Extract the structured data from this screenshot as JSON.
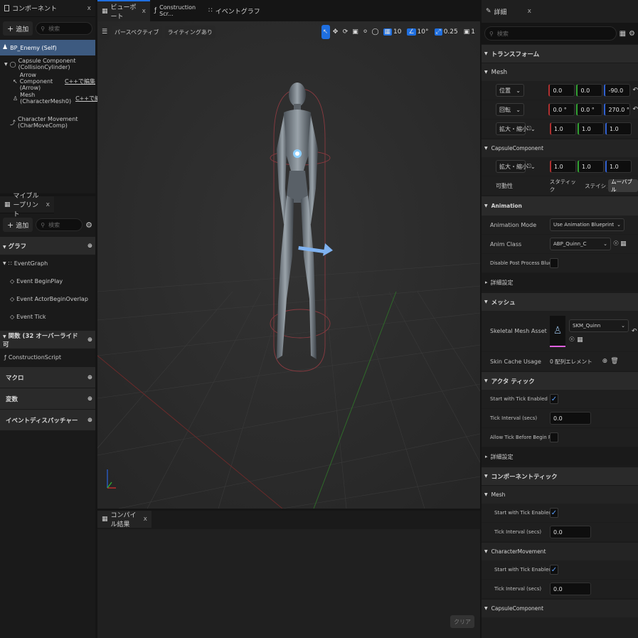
{
  "components_panel": {
    "tab_label": "コンポーネント",
    "add_label": "追加",
    "search_placeholder": "検索",
    "tree": [
      {
        "label": "BP_Enemy (Self)",
        "selected": true
      },
      {
        "label": "Capsule Component (CollisionCylinder)"
      },
      {
        "label": "Arrow Component (Arrow)",
        "edit_link": "C++で編集"
      },
      {
        "label": "Mesh (CharacterMesh0)",
        "edit_link": "C++で編集"
      },
      {
        "label": "Character Movement (CharMoveComp)"
      }
    ]
  },
  "myblueprint_panel": {
    "tab_label": "マイブループリント",
    "add_label": "追加",
    "search_placeholder": "検索",
    "sections": {
      "graph": "グラフ",
      "functions": "関数 (32 オーバーライド可",
      "macros": "マクロ",
      "variables": "変数",
      "dispatchers": "イベントディスパッチャー"
    },
    "event_graph": "EventGraph",
    "events": [
      "Event BeginPlay",
      "Event ActorBeginOverlap",
      "Event Tick"
    ],
    "construction_script": "ConstructionScript"
  },
  "center_tabs": {
    "viewport": "ビューポート",
    "construction": "Construction Scr...",
    "event_graph": "イベントグラフ"
  },
  "viewport_toolbar": {
    "perspective": "パースペクティブ",
    "lighting": "ライティングあり",
    "grid_snap": "10",
    "rot_snap": "10°",
    "scale_snap": "0.25",
    "camera_speed": "1"
  },
  "compile_panel": {
    "tab_label": "コンパイル結果",
    "clear_label": "クリア"
  },
  "details_panel": {
    "tab_label": "詳細",
    "search_placeholder": "検索",
    "transform_section": "トランスフォーム",
    "mesh_sub": "Mesh",
    "location_label": "位置",
    "location": [
      "0.0",
      "0.0",
      "-90.0"
    ],
    "rotation_label": "回転",
    "rotation": [
      "0.0 °",
      "0.0 °",
      "270.0 °"
    ],
    "scale_label": "拡大・縮小",
    "scale": [
      "1.0",
      "1.0",
      "1.0"
    ],
    "capsule_sub": "CapsuleComponent",
    "capsule_scale": [
      "1.0",
      "1.0",
      "1.0"
    ],
    "mobility_label": "可動性",
    "mobility_options": [
      "スタティック",
      "ステイショナリ",
      "ムーバブル"
    ],
    "animation_section": "Animation",
    "anim_mode_label": "Animation Mode",
    "anim_mode_value": "Use Animation Blueprint",
    "anim_class_label": "Anim Class",
    "anim_class_value": "ABP_Quinn_C",
    "disable_pp_label": "Disable Post Process Blueprint",
    "advanced_label": "詳細設定",
    "mesh_section": "メッシュ",
    "skeletal_label": "Skeletal Mesh Asset",
    "skeletal_value": "SKM_Quinn",
    "skin_cache_label": "Skin Cache Usage",
    "skin_cache_value": "0 配列エレメント",
    "actor_tick_section": "アクタ ティック",
    "start_tick_label": "Start with Tick Enabled",
    "tick_interval_label": "Tick Interval (secs)",
    "tick_interval_value": "0.0",
    "allow_tick_label": "Allow Tick Before Begin Play",
    "advanced2_label": "詳細設定",
    "component_tick_section": "コンポーネントティック",
    "ct_mesh": "Mesh",
    "ct_mesh_start": "Start with Tick Enabled",
    "ct_mesh_interval_label": "Tick Interval (secs)",
    "ct_mesh_interval": "0.0",
    "ct_charmove": "CharacterMovement",
    "ct_cm_start": "Start with Tick Enabled",
    "ct_cm_interval_label": "Tick Interval (secs)",
    "ct_cm_interval": "0.0",
    "ct_capsule": "CapsuleComponent"
  },
  "colors": {
    "accent": "#1f6fe0",
    "selection": "#3d5a80",
    "panel": "#1f1f1f"
  }
}
